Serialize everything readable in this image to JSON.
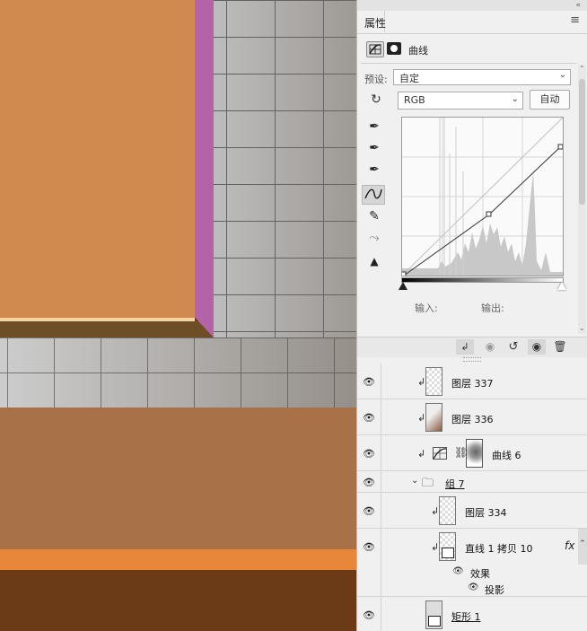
{
  "properties_panel": {
    "tab_title": "属性",
    "adjustment_name": "曲线",
    "preset_label": "预设:",
    "preset_value": "自定",
    "channel_value": "RGB",
    "auto_button": "自动",
    "input_label": "输入:",
    "output_label": "输出:"
  },
  "layers": [
    {
      "name": "图层 337"
    },
    {
      "name": "图层 336"
    },
    {
      "name": "曲线 6"
    },
    {
      "name": "组 7"
    },
    {
      "name": "图层 334"
    },
    {
      "name": "直线 1 拷贝 10",
      "fx": "fx"
    },
    {
      "name": "效果"
    },
    {
      "name": "投影"
    },
    {
      "name": "矩形 1"
    }
  ],
  "colors": {
    "poster_orange": "#d08a50",
    "purple_edge": "#b463a8",
    "wall_brown": "#a87148",
    "stripe_orange": "#e8873a",
    "floor_brown": "#6b3b17",
    "panel_bg": "#f0f0f0"
  },
  "icons": {
    "curves_preset": "curves-grid-icon",
    "mask": "mask-icon",
    "eye": "eye-icon",
    "folder": "folder-icon",
    "trash": "trash-icon",
    "reset": "reset-icon",
    "visibility": "visibility-icon"
  }
}
